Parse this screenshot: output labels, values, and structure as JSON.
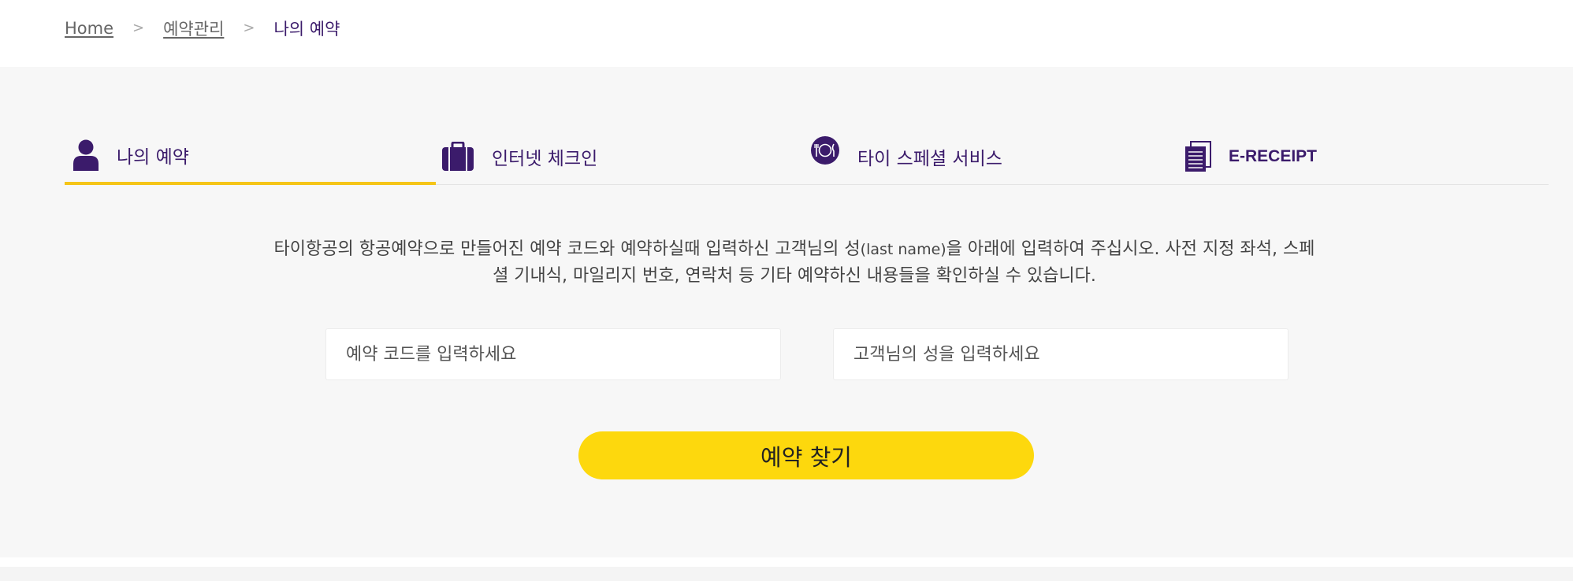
{
  "breadcrumb": {
    "home": "Home",
    "separator": ">",
    "manage": "예약관리",
    "current": "나의 예약"
  },
  "tabs": [
    {
      "label": "나의 예약",
      "icon": "user-icon",
      "active": true
    },
    {
      "label": "인터넷 체크인",
      "icon": "suitcase-icon",
      "active": false
    },
    {
      "label": "타이 스페셜 서비스",
      "icon": "dining-plate-icon",
      "active": false
    },
    {
      "label": "E-RECEIPT",
      "icon": "document-icon",
      "active": false
    }
  ],
  "description": {
    "part1": "타이항공의 항공예약으로 만들어진 예약 코드와 예약하실때 입력하신 고객님의 성",
    "part2": "(last name)",
    "part3": "을 아래에 입력하여 주십시오. 사전 지정 좌석, 스페셜 기내식, 마일리지 번호, 연락처 등 기타 예약하신 내용들을 확인하실 수 있습니다."
  },
  "form": {
    "booking_code_placeholder": "예약 코드를 입력하세요",
    "booking_code_value": "",
    "last_name_placeholder": "고객님의 성을 입력하세요",
    "last_name_value": "",
    "search_button_label": "예약 찾기"
  },
  "colors": {
    "brand_purple": "#3b1b6b",
    "accent_yellow": "#fdd80d",
    "tab_underline": "#f5c518",
    "background_gray": "#f7f7f7"
  }
}
